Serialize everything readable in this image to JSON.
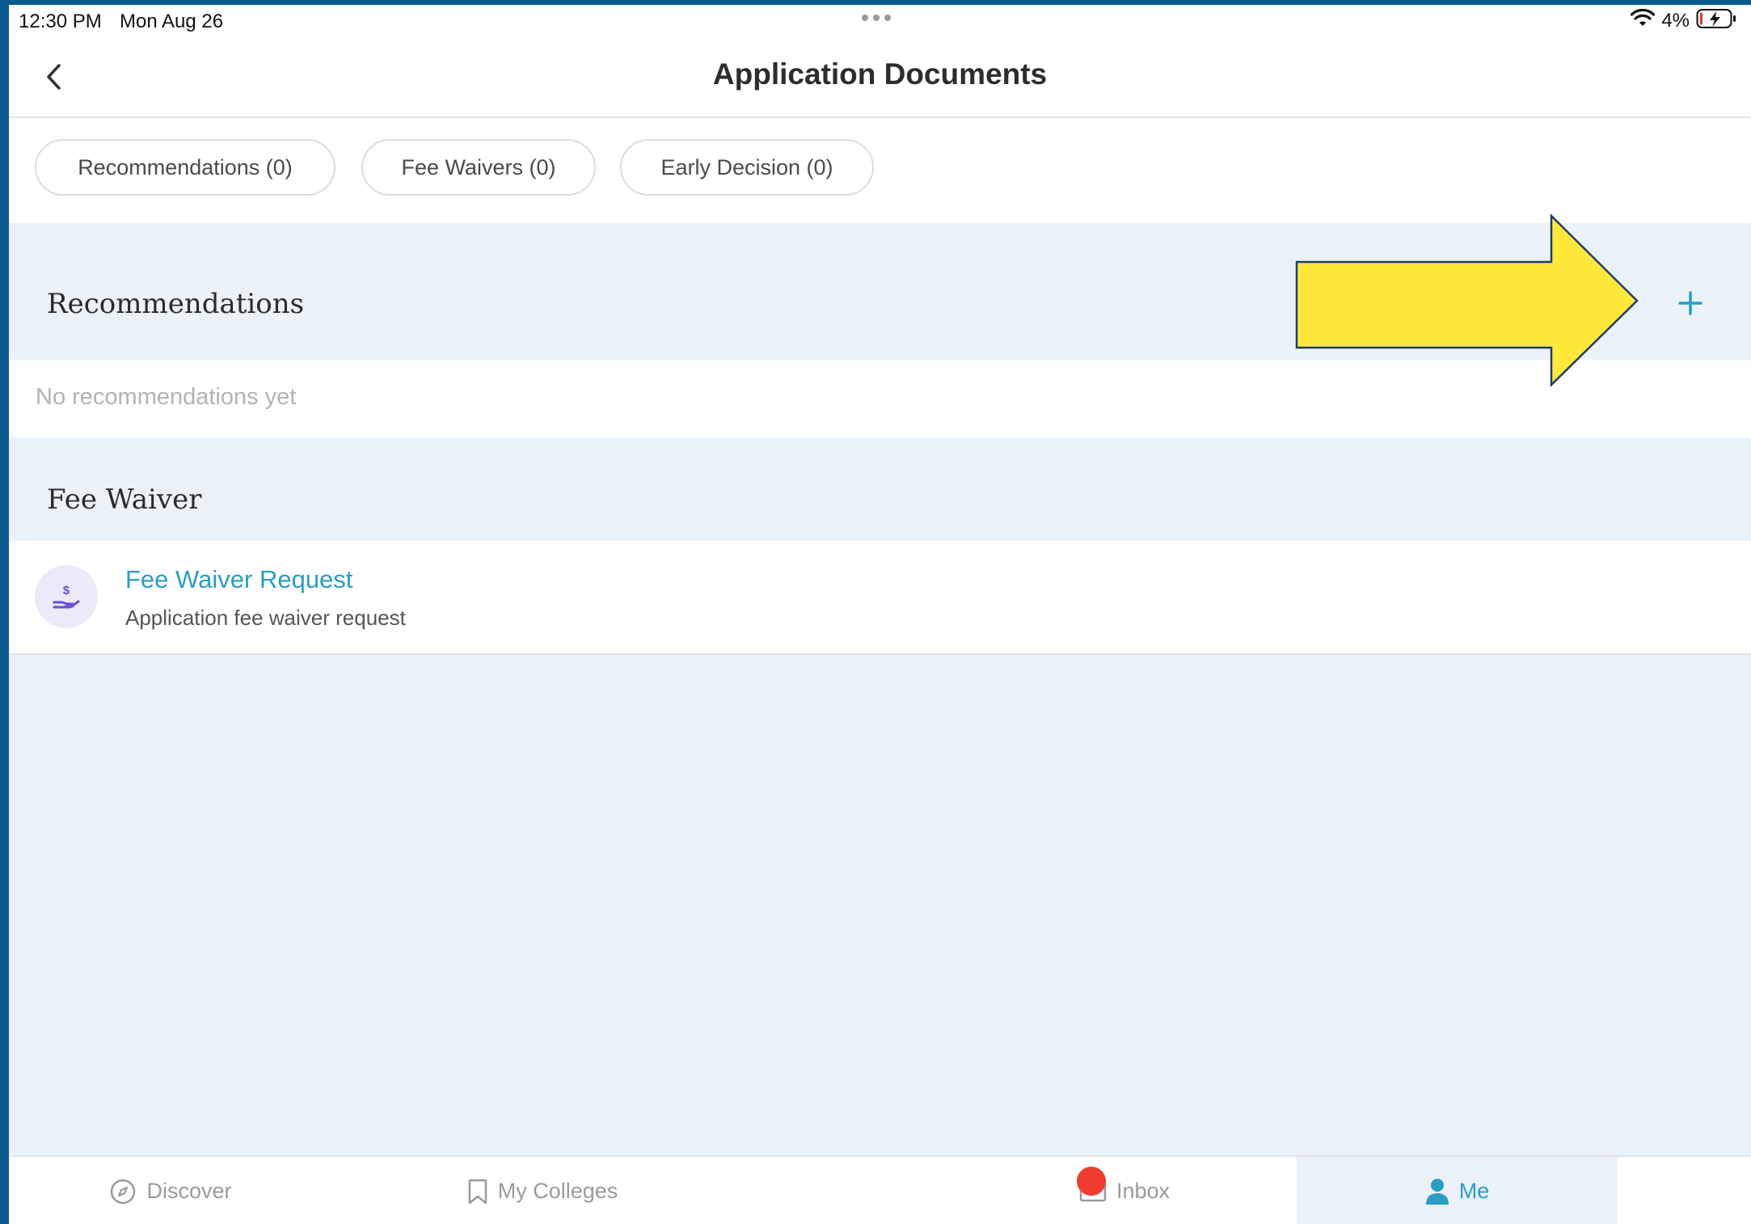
{
  "status_bar": {
    "time": "12:30 PM",
    "date": "Mon Aug 26",
    "battery": "4%",
    "icons": [
      "wifi-icon",
      "battery-charging-icon"
    ]
  },
  "header": {
    "title": "Application Documents",
    "back_icon": "chevron-left-icon"
  },
  "filter_chips": [
    {
      "label": "Recommendations (0)"
    },
    {
      "label": "Fee Waivers (0)"
    },
    {
      "label": "Early Decision (0)"
    }
  ],
  "recommendations": {
    "title": "Recommendations",
    "add_icon": "plus-icon",
    "empty_text": "No recommendations yet"
  },
  "fee_waiver": {
    "title": "Fee Waiver",
    "items": [
      {
        "title": "Fee Waiver Request",
        "subtitle": "Application fee waiver request",
        "icon": "hand-dollar-icon"
      }
    ]
  },
  "annotation": {
    "type": "arrow",
    "color": "#FFE839",
    "points_to": "recommendations add button"
  },
  "tab_bar": {
    "tabs": [
      {
        "label": "Discover",
        "icon": "compass-icon"
      },
      {
        "label": "My Colleges",
        "icon": "bookmark-icon"
      },
      {
        "label": "Inbox",
        "icon": "mail-icon",
        "has_badge": true
      },
      {
        "label": "Me",
        "icon": "person-icon",
        "active": true
      }
    ]
  },
  "colors": {
    "accent": "#2A9DC4",
    "background": "#EBF2F7",
    "badge": "#F23B2F",
    "frame": "#0B5A8F"
  }
}
